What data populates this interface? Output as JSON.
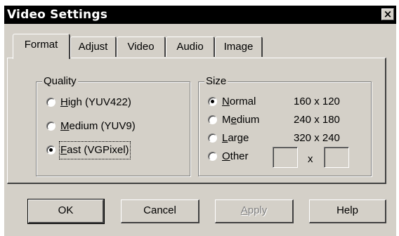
{
  "window": {
    "title": "Video Settings",
    "close_label": "×"
  },
  "tabs": [
    {
      "label": "Format",
      "active": true
    },
    {
      "label": "Adjust",
      "active": false
    },
    {
      "label": "Video",
      "active": false
    },
    {
      "label": "Audio",
      "active": false
    },
    {
      "label": "Image",
      "active": false
    }
  ],
  "quality": {
    "label": "Quality",
    "options": [
      {
        "mnemonic": "H",
        "rest": "igh (YUV422)",
        "checked": false
      },
      {
        "mnemonic": "M",
        "rest": "edium (YUV9)",
        "checked": false
      },
      {
        "mnemonic": "F",
        "rest": "ast (VGPixel)",
        "checked": true
      }
    ]
  },
  "size": {
    "label": "Size",
    "options": [
      {
        "mnemonic": "N",
        "rest": "ormal",
        "value": "160 x 120",
        "checked": true
      },
      {
        "pre": "M",
        "mnemonic": "e",
        "rest": "dium",
        "value": "240 x 180",
        "checked": false
      },
      {
        "mnemonic": "L",
        "rest": "arge",
        "value": "320 x 240",
        "checked": false
      },
      {
        "mnemonic": "O",
        "rest": "ther",
        "checked": false
      }
    ],
    "other_width": "",
    "other_height": "",
    "separator": "x"
  },
  "buttons": {
    "ok": "OK",
    "cancel": "Cancel",
    "apply_mnemonic": "A",
    "apply_rest": "pply",
    "help": "Help"
  }
}
